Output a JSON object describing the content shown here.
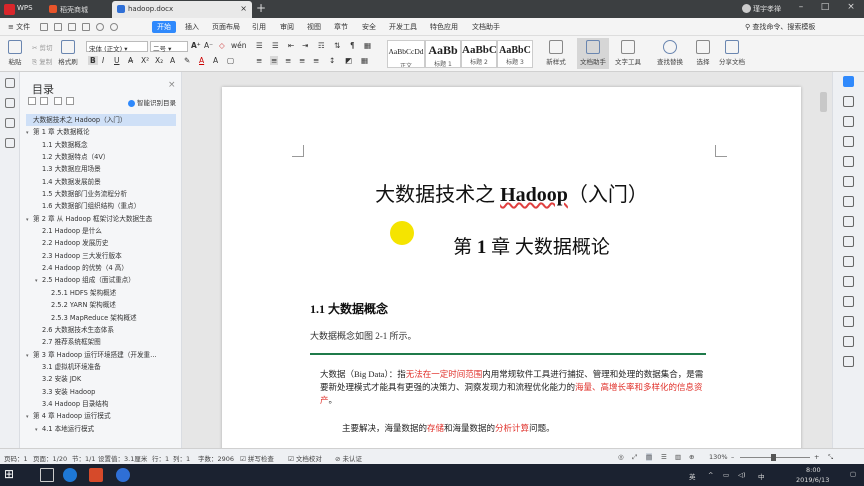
{
  "titlebar": {
    "app_label": "WPS",
    "tabs": [
      {
        "label": "稻壳商城"
      },
      {
        "label": "hadoop.docx"
      }
    ],
    "user": "瑾宇孝禅"
  },
  "menubar": {
    "file": "文件",
    "items": [
      "开始",
      "插入",
      "页面布局",
      "引用",
      "审阅",
      "视图",
      "章节",
      "安全",
      "开发工具",
      "特色应用",
      "文档助手"
    ],
    "search": "查找命令、搜索模板"
  },
  "ribbon": {
    "cut": "剪切",
    "copy": "复制",
    "paste": "粘贴",
    "format_painter": "格式刷",
    "font_name": "宋体 (正文)",
    "font_size": "二号",
    "styles": [
      {
        "preview": "AaBbCcDd",
        "label": "正文"
      },
      {
        "preview": "AaBb",
        "label": "标题 1"
      },
      {
        "preview": "AaBbC",
        "label": "标题 2"
      },
      {
        "preview": "AaBbC",
        "label": "标题 3"
      }
    ],
    "new_style": "新样式",
    "doc_assistant": "文档助手",
    "text_tools": "文字工具",
    "find_replace": "查找替换",
    "select": "选择",
    "share": "分享文档"
  },
  "toc": {
    "title": "目录",
    "smart": "智能识别目录",
    "items": [
      {
        "label": "大数据技术之 Hadoop（入门）",
        "level": 0,
        "selected": true
      },
      {
        "label": "第 1 章  大数据概论",
        "level": 0,
        "caret": true
      },
      {
        "label": "1.1  大数据概念",
        "level": 1
      },
      {
        "label": "1.2  大数据特点（4V）",
        "level": 1
      },
      {
        "label": "1.3  大数据应用场景",
        "level": 1
      },
      {
        "label": "1.4  大数据发展前景",
        "level": 1
      },
      {
        "label": "1.5  大数据部门业务流程分析",
        "level": 1
      },
      {
        "label": "1.6  大数据部门组织结构（重点）",
        "level": 1
      },
      {
        "label": "第 2 章  从 Hadoop 框架讨论大数据生态",
        "level": 0,
        "caret": true
      },
      {
        "label": "2.1 Hadoop 是什么",
        "level": 1
      },
      {
        "label": "2.2 Hadoop 发展历史",
        "level": 1
      },
      {
        "label": "2.3 Hadoop 三大发行版本",
        "level": 1
      },
      {
        "label": "2.4 Hadoop 的优势（4 高）",
        "level": 1
      },
      {
        "label": "2.5 Hadoop 组成（面试重点）",
        "level": 1,
        "caret": true
      },
      {
        "label": "2.5.1 HDFS 架构概述",
        "level": 2
      },
      {
        "label": "2.5.2 YARN 架构概述",
        "level": 2
      },
      {
        "label": "2.5.3 MapReduce 架构概述",
        "level": 2
      },
      {
        "label": "2.6  大数据技术生态体系",
        "level": 1
      },
      {
        "label": "2.7  推荐系统框架图",
        "level": 1
      },
      {
        "label": "第 3 章  Hadoop 运行环境搭建（开发重…",
        "level": 0,
        "caret": true
      },
      {
        "label": "3.1  虚拟机环境准备",
        "level": 1
      },
      {
        "label": "3.2  安装 JDK",
        "level": 1
      },
      {
        "label": "3.3  安装 Hadoop",
        "level": 1
      },
      {
        "label": "3.4 Hadoop 目录结构",
        "level": 1
      },
      {
        "label": "第 4 章  Hadoop 运行模式",
        "level": 0,
        "caret": true
      },
      {
        "label": "4.1  本地运行模式",
        "level": 1,
        "caret": true
      }
    ]
  },
  "document": {
    "title_prefix": "大数据技术之 ",
    "title_hl": "Hadoop",
    "title_suffix": "（入门）",
    "chapter_prefix": "第 ",
    "chapter_num": "1",
    "chapter_suffix": " 章  大数据概论",
    "section": "1.1  大数据概念",
    "section_note": "大数据概念如图 2-1 所示。",
    "para1": [
      {
        "t": "大数据（Big Data）：指",
        "red": false
      },
      {
        "t": "无法在一定时间范围",
        "red": true
      },
      {
        "t": "内用常规软件工具进行捕捉、管理和处理的数据集合，是需要新处理模式才能具有更强的决策力、洞察发现力和流程优化能力的",
        "red": false
      },
      {
        "t": "海量、高增长率和多样化的信息资产",
        "red": true
      },
      {
        "t": "。",
        "red": false
      }
    ],
    "para2": [
      {
        "t": "主要解决，海量数据的",
        "red": false
      },
      {
        "t": "存储",
        "red": true
      },
      {
        "t": "和海量数据的",
        "red": false
      },
      {
        "t": "分析计算",
        "red": true
      },
      {
        "t": "问题。",
        "red": false
      }
    ]
  },
  "statusbar": {
    "page": "页码：1",
    "pages": "页面：1/20",
    "section": "节：1/1",
    "setting": "设置值：3.1厘米",
    "row": "行：1",
    "col": "列：1",
    "words": "字数：2906",
    "spell": "拼写检查",
    "proof": "文档校对",
    "cert": "未认证",
    "zoom": "130%"
  },
  "taskbar": {
    "time": "8:00",
    "date": "2019/6/13",
    "ime": "英"
  }
}
